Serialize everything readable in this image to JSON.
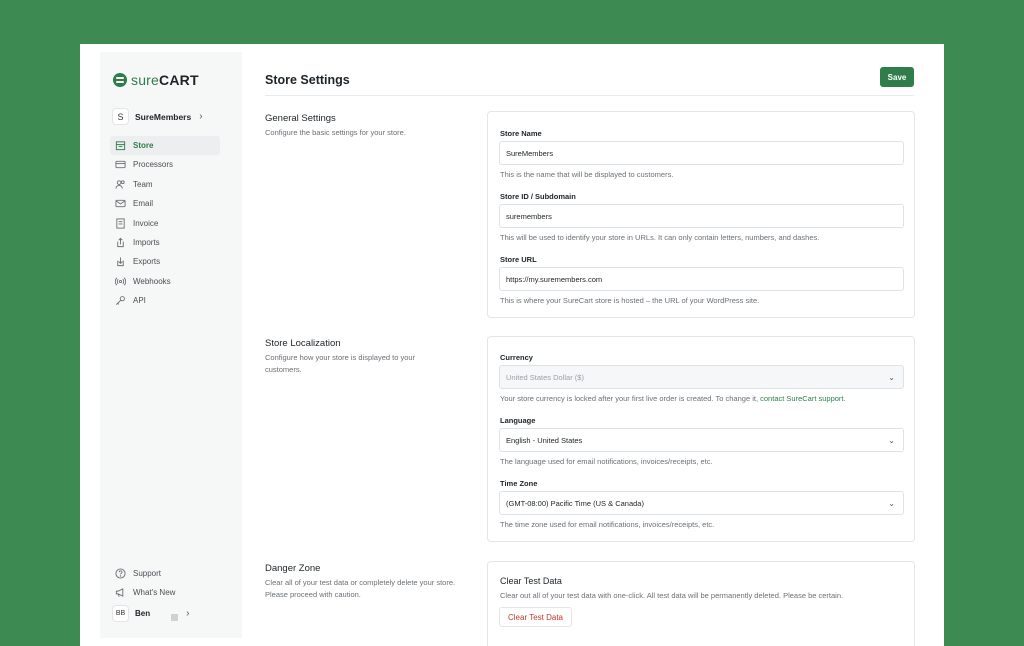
{
  "brand": {
    "part1": "sure",
    "part2": "CART",
    "accent": "#2f7d4a"
  },
  "store_switcher": {
    "initial": "S",
    "name": "SureMembers"
  },
  "sidebar": {
    "items": [
      {
        "label": "Store",
        "icon": "store-icon",
        "active": true
      },
      {
        "label": "Processors",
        "icon": "credit-card-icon"
      },
      {
        "label": "Team",
        "icon": "users-icon"
      },
      {
        "label": "Email",
        "icon": "mail-icon"
      },
      {
        "label": "Invoice",
        "icon": "invoice-icon"
      },
      {
        "label": "Imports",
        "icon": "upload-icon"
      },
      {
        "label": "Exports",
        "icon": "download-icon"
      },
      {
        "label": "Webhooks",
        "icon": "broadcast-icon"
      },
      {
        "label": "API",
        "icon": "key-icon"
      }
    ],
    "bottom": [
      {
        "label": "Support",
        "icon": "help-circle-icon"
      },
      {
        "label": "What's New",
        "icon": "megaphone-icon"
      }
    ],
    "user": {
      "initials": "BB",
      "name": "Ben"
    }
  },
  "page": {
    "title": "Store Settings",
    "save_label": "Save"
  },
  "general": {
    "title": "General Settings",
    "desc": "Configure the basic settings for your store.",
    "store_name_label": "Store Name",
    "store_name_value": "SureMembers",
    "store_name_help": "This is the name that will be displayed to customers.",
    "store_id_label": "Store ID / Subdomain",
    "store_id_value": "suremembers",
    "store_id_help": "This will be used to identify your store in URLs. It can only contain letters, numbers, and dashes.",
    "store_url_label": "Store URL",
    "store_url_value": "https://my.suremembers.com",
    "store_url_help": "This is where your SureCart store is hosted – the URL of your WordPress site."
  },
  "localization": {
    "title": "Store Localization",
    "desc": "Configure how your store is displayed to your customers.",
    "currency_label": "Currency",
    "currency_value": "United States Dollar ($)",
    "currency_help": "Your store currency is locked after your first live order is created. To change it,",
    "currency_help_link": "contact SureCart support",
    "language_label": "Language",
    "language_value": "English - United States",
    "language_help": "The language used for email notifications, invoices/receipts, etc.",
    "timezone_label": "Time Zone",
    "timezone_value": "(GMT-08:00) Pacific Time (US & Canada)",
    "timezone_help": "The time zone used for email notifications, invoices/receipts, etc."
  },
  "danger": {
    "title": "Danger Zone",
    "desc": "Clear all of your test data or completely delete your store. Please proceed with caution.",
    "card_title": "Clear Test Data",
    "card_desc": "Clear out all of your test data with one-click. All test data will be permanently deleted. Please be certain.",
    "button_label": "Clear Test Data"
  }
}
